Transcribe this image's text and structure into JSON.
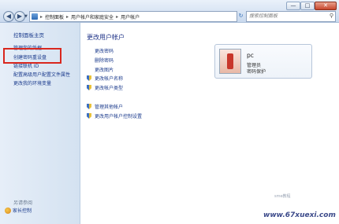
{
  "window": {
    "minimize_glyph": "—",
    "maximize_glyph": "□",
    "close_glyph": "✕"
  },
  "nav": {
    "back_glyph": "◀",
    "forward_glyph": "▶",
    "dropdown_glyph": "▼"
  },
  "address": {
    "crumbs": [
      "控制面板",
      "用户帐户和家庭安全",
      "用户帐户"
    ],
    "separator": "▸",
    "refresh_glyph": "↻"
  },
  "search": {
    "placeholder": "搜索控制面板",
    "icon_glyph": "⚲"
  },
  "sidebar": {
    "home": "控制面板主页",
    "links": [
      "管理您的凭据",
      "创建密码重设盘",
      "链接联机 ID",
      "配置高级用户配置文件属性",
      "更改我的环境变量"
    ],
    "see_also": "另请参阅",
    "parental_controls": "家长控制"
  },
  "main": {
    "title": "更改用户帐户",
    "tasks": [
      "更改密码",
      "删除密码",
      "更改图片",
      "更改帐户名称",
      "更改帐户类型",
      "管理其他帐户",
      "更改用户帐户控制设置"
    ]
  },
  "account": {
    "name": "pc",
    "role": "管理员",
    "password_status": "密码保护"
  },
  "watermark": {
    "site": "www.67xuexi.com",
    "logo": "sme教程"
  }
}
